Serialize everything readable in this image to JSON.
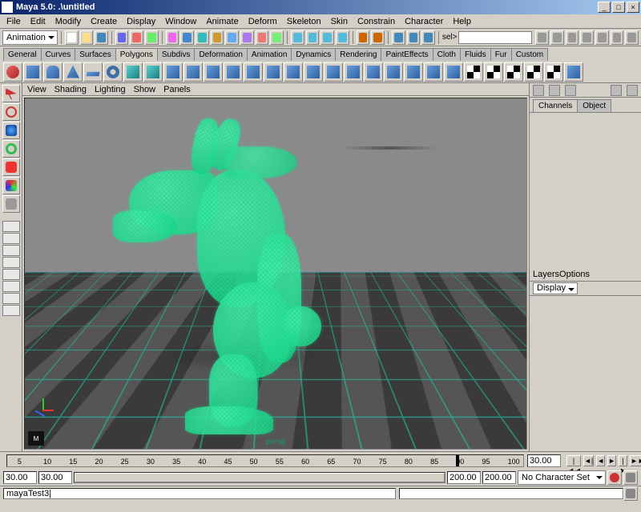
{
  "title": "Maya 5.0: .\\untitled",
  "menu": [
    "File",
    "Edit",
    "Modify",
    "Create",
    "Display",
    "Window",
    "Animate",
    "Deform",
    "Skeleton",
    "Skin",
    "Constrain",
    "Character",
    "Help"
  ],
  "module": "Animation",
  "selmask_label": "sel>",
  "shelf_tabs": [
    "General",
    "Curves",
    "Surfaces",
    "Polygons",
    "Subdivs",
    "Deformation",
    "Animation",
    "Dynamics",
    "Rendering",
    "PaintEffects",
    "Cloth",
    "Fluids",
    "Fur",
    "Custom"
  ],
  "shelf_active": "Polygons",
  "view_menu": [
    "View",
    "Shading",
    "Lighting",
    "Show",
    "Panels"
  ],
  "viewport_label": "persp",
  "right": {
    "channels_tab": "Channels",
    "object_tab": "Object",
    "layers_tab": "Layers",
    "options_tab": "Options",
    "display_label": "Display"
  },
  "timeline": {
    "ticks": [
      "5",
      "10",
      "15",
      "20",
      "25",
      "30",
      "35",
      "40",
      "45",
      "50",
      "55",
      "60",
      "65",
      "70",
      "75",
      "80",
      "85",
      "90",
      "95",
      "100"
    ],
    "current_frame": "30.00",
    "marker_at": "90",
    "range_start": "30.00",
    "range_end_a": "200.00",
    "range_end_b": "200.00",
    "charset": "No Character Set"
  },
  "playback": {
    "rew": "|◄◄",
    "sb": "◄|",
    "pb": "◄",
    "pf": "►",
    "sf": "|►",
    "ff": "►►|"
  },
  "cmd": "mayaTest3|"
}
